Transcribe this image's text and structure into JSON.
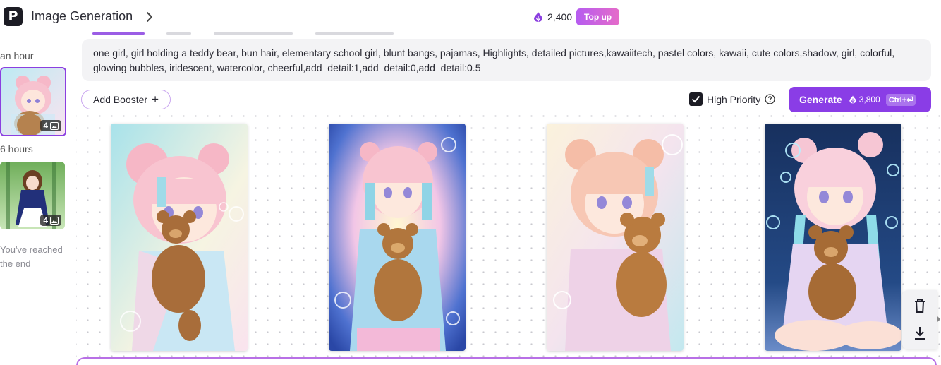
{
  "header": {
    "logo_letter": "P",
    "title": "Image Generation",
    "credits": "2,400",
    "topup_label": "Top up"
  },
  "history": {
    "groups": [
      {
        "time_label": "an hour",
        "count": "4"
      },
      {
        "time_label": "6 hours",
        "count": "4"
      }
    ],
    "end_text": "You've reached the end"
  },
  "prompt": {
    "text": "one girl, girl holding a teddy bear, bun hair, elementary school girl, blunt bangs, pajamas, Highlights, detailed pictures,kawaiitech, pastel colors, kawaii, cute colors,shadow, girl, colorful, glowing bubbles, iridescent, watercolor, cheerful,add_detail:1,add_detail:0,add_detail:0.5"
  },
  "controls": {
    "add_booster_label": "Add Booster",
    "high_priority_label": "High Priority",
    "high_priority_checked": true,
    "generate_label": "Generate",
    "generate_cost": "3,800",
    "generate_shortcut": "Ctrl+⏎"
  },
  "images": [
    {
      "name": "generated-image-1",
      "bg": "#bfe6ee"
    },
    {
      "name": "generated-image-2",
      "bg": "#2d4fb0"
    },
    {
      "name": "generated-image-3",
      "bg": "#f5ecd8"
    },
    {
      "name": "generated-image-4",
      "bg": "#1e3566"
    }
  ],
  "colors": {
    "accent": "#8a3de6",
    "topup_gradient_start": "#b65cf0",
    "topup_gradient_end": "#e56bc9"
  }
}
